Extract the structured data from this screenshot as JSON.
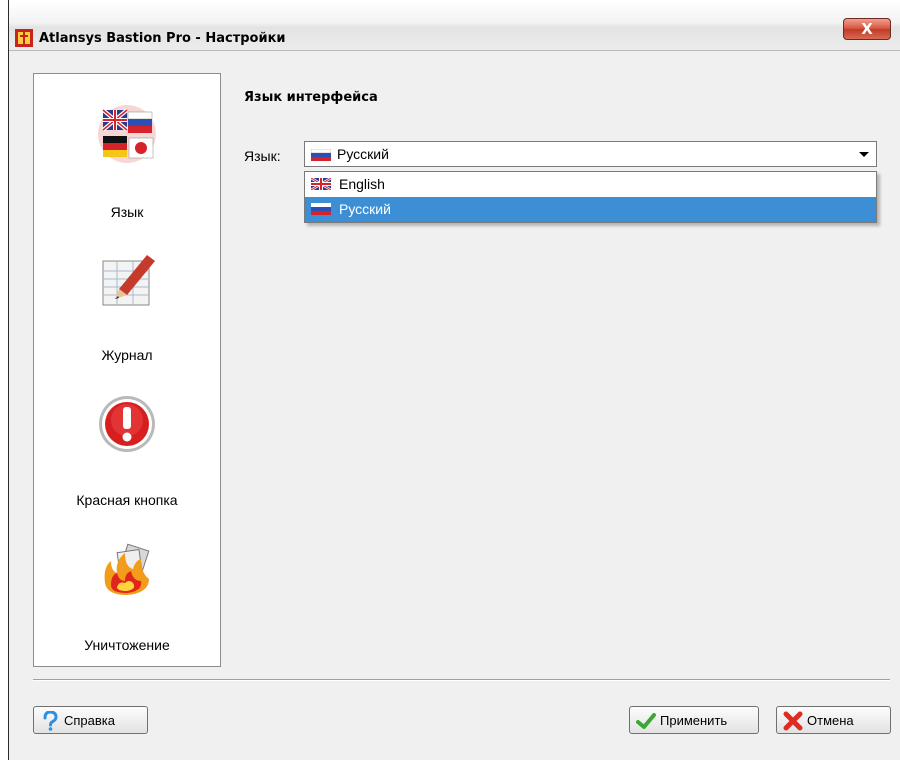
{
  "window": {
    "title": "Atlansys Bastion Pro - Настройки",
    "close_label": "X"
  },
  "sidebar": {
    "items": [
      {
        "label": "Язык",
        "icon": "language-flags-icon"
      },
      {
        "label": "Журнал",
        "icon": "journal-icon"
      },
      {
        "label": "Красная кнопка",
        "icon": "red-button-icon"
      },
      {
        "label": "Уничтожение",
        "icon": "destruction-fire-icon"
      }
    ]
  },
  "main": {
    "heading": "Язык интерфейса",
    "language_label": "Язык:",
    "language_selected": "Русский",
    "language_options": [
      {
        "label": "English",
        "icon": "uk-flag-icon",
        "selected": false
      },
      {
        "label": "Русский",
        "icon": "russia-flag-icon",
        "selected": true
      }
    ]
  },
  "footer": {
    "help_label": "Справка",
    "apply_label": "Применить",
    "cancel_label": "Отмена"
  },
  "colors": {
    "selection": "#3d8fd5",
    "close_button": "#c03a24"
  }
}
